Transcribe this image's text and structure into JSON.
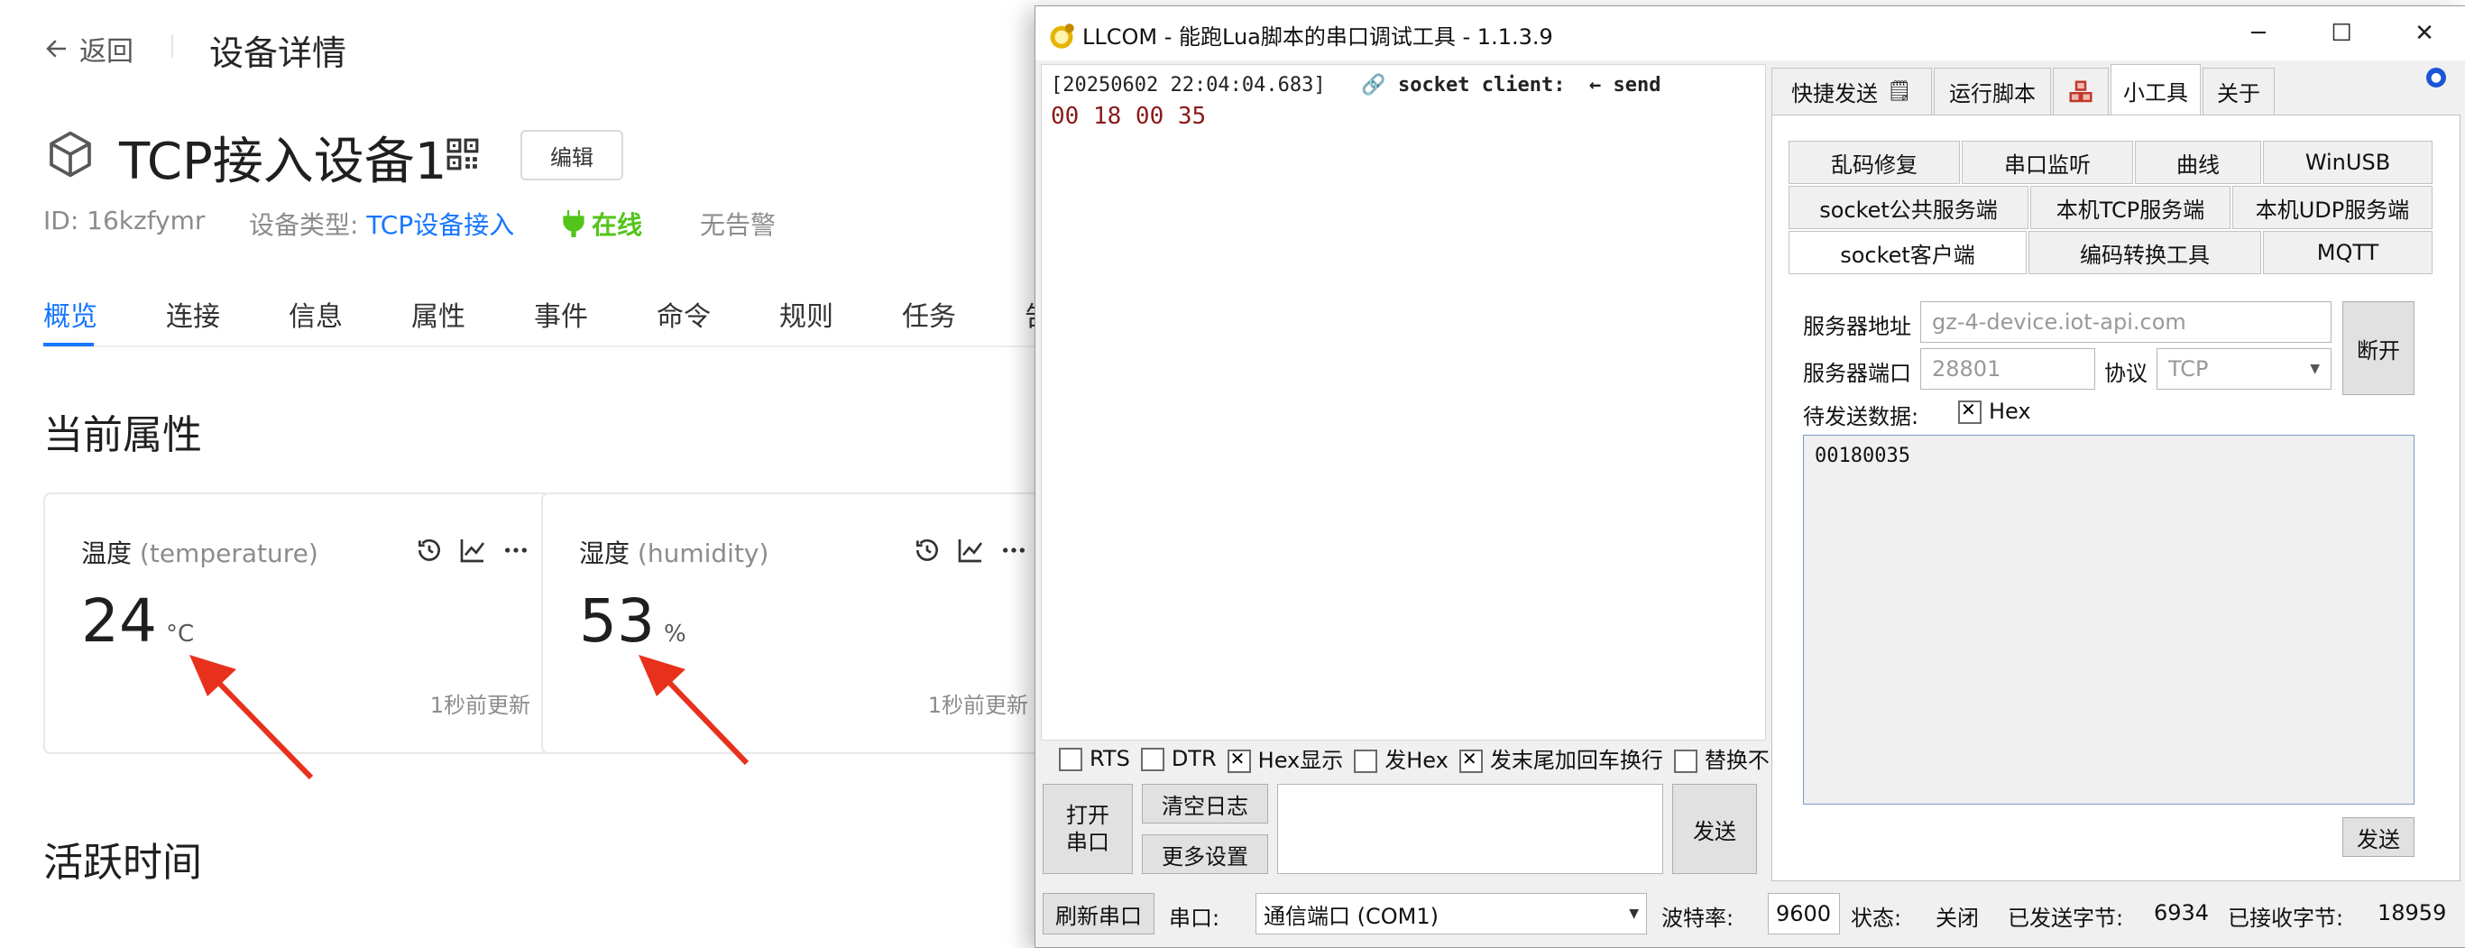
{
  "page": {
    "back_label": "返回",
    "breadcrumb_title": "设备详情",
    "device_name": "TCP接入设备1",
    "edit_label": "编辑",
    "id_text": "ID: 16kzfymr",
    "type_label": "设备类型:",
    "type_value": "TCP设备接入",
    "online_label": "在线",
    "alarm_label": "无告警",
    "tabs": [
      "概览",
      "连接",
      "信息",
      "属性",
      "事件",
      "命令",
      "规则",
      "任务",
      "告"
    ],
    "section_current": "当前属性",
    "section_active": "活跃时间",
    "cards": [
      {
        "label": "温度",
        "en": "(temperature)",
        "value": "24",
        "unit": "°C",
        "updated": "1秒前更新"
      },
      {
        "label": "湿度",
        "en": "(humidity)",
        "value": "53",
        "unit": "%",
        "updated": "1秒前更新"
      }
    ],
    "accent": "#1677ff",
    "online_color": "#52c41a",
    "arrow_color": "#e8311c"
  },
  "app": {
    "title": "LLCOM - 能跑Lua脚本的串口调试工具 - 1.1.3.9",
    "log": {
      "timestamp": "[20250602 22:04:04.683]",
      "source": "socket client:",
      "direction": "← send",
      "data": "00 18 00 35"
    },
    "checks": [
      {
        "label": "RTS",
        "checked": false
      },
      {
        "label": "DTR",
        "checked": false
      },
      {
        "label": "Hex显示",
        "checked": true
      },
      {
        "label": "发Hex",
        "checked": false
      },
      {
        "label": "发末尾加回车换行",
        "checked": true
      },
      {
        "label": "替换不",
        "checked": false
      }
    ],
    "open_port": "打开\n串口",
    "clear_log": "清空日志",
    "more_settings": "更多设置",
    "send_label": "发送",
    "top_tabs": [
      "快捷发送",
      "运行脚本",
      "",
      "小工具",
      "关于"
    ],
    "tool_tabs_row1": [
      "乱码修复",
      "串口监听",
      "曲线",
      "WinUSB"
    ],
    "tool_tabs_row2": [
      "socket公共服务端",
      "本机TCP服务端",
      "本机UDP服务端"
    ],
    "tool_tabs_row3": [
      "socket客户端",
      "编码转换工具",
      "MQTT"
    ],
    "server_addr_label": "服务器地址",
    "server_addr_value": "gz-4-device.iot-api.com",
    "server_port_label": "服务器端口",
    "server_port_value": "28801",
    "protocol_label": "协议",
    "protocol_value": "TCP",
    "disconnect_label": "断开",
    "pending_label": "待发送数据:",
    "hex_label": "Hex",
    "hex_checked": true,
    "pending_data": "00180035",
    "tool_send_label": "发送",
    "status": {
      "refresh_port": "刷新串口",
      "port_label": "串口:",
      "port_value": "通信端口 (COM1)",
      "baud_label": "波特率:",
      "baud_value": "9600",
      "state_label": "状态:",
      "state_value": "关闭",
      "sent_label": "已发送字节:",
      "sent_value": "6934",
      "recv_label": "已接收字节:",
      "recv_value": "18959"
    }
  }
}
